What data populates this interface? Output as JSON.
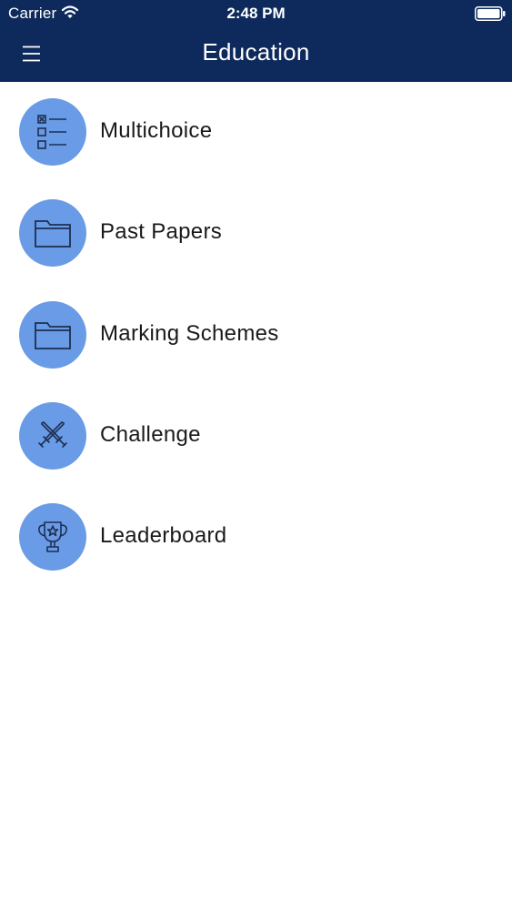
{
  "status_bar": {
    "carrier": "Carrier",
    "time": "2:48 PM",
    "wifi_icon": "wifi-icon",
    "battery_icon": "battery-icon"
  },
  "nav": {
    "title": "Education",
    "menu_icon": "hamburger-menu-icon"
  },
  "colors": {
    "nav_background": "#0e2a5c",
    "icon_circle": "#6a9be6",
    "icon_stroke": "#1d2f52",
    "label_text": "#1a1a1a"
  },
  "menu": {
    "items": [
      {
        "label": "Multichoice",
        "icon": "checklist-icon"
      },
      {
        "label": "Past Papers",
        "icon": "folder-icon"
      },
      {
        "label": "Marking Schemes",
        "icon": "folder-icon"
      },
      {
        "label": "Challenge",
        "icon": "crossed-swords-icon"
      },
      {
        "label": "Leaderboard",
        "icon": "trophy-icon"
      }
    ]
  }
}
